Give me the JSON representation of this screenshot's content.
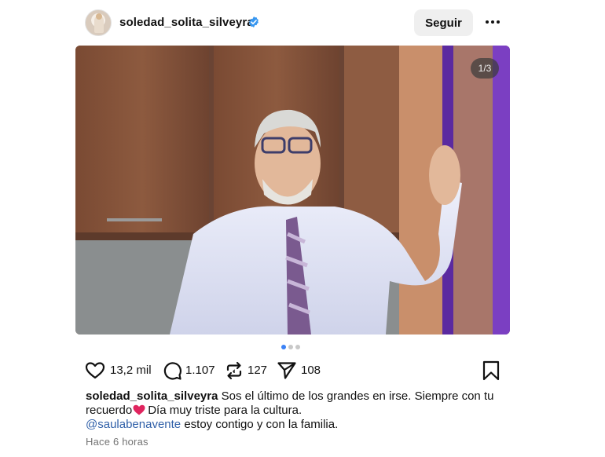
{
  "post": {
    "username": "soledad_solita_silveyra",
    "follow_label": "Seguir",
    "image_counter": "1/3",
    "slide_count": 3,
    "active_slide": 1,
    "stats": {
      "likes": "13,2 mil",
      "comments": "1.107",
      "reposts": "127",
      "shares": "108"
    },
    "caption": {
      "username": "soledad_solita_silveyra",
      "text_line1": "Sos el último de los grandes en irse. Siempre con tu",
      "text_line2a": "recuerdo",
      "text_line2b": "Día muy triste para la cultura.",
      "mention": "@saulabenavente",
      "text_line3": "estoy contigo y con la familia."
    },
    "time": "Hace 6 horas"
  },
  "colors": {
    "verified": "#3897f0",
    "mention": "#2f5fa8",
    "heart_emoji": "#e0245e",
    "dot_active": "#3b82f6"
  },
  "icons": [
    "verified-badge-icon",
    "more-options-icon",
    "heart-icon",
    "comment-icon",
    "repost-icon",
    "share-icon",
    "bookmark-icon",
    "heart-emoji-icon"
  ]
}
